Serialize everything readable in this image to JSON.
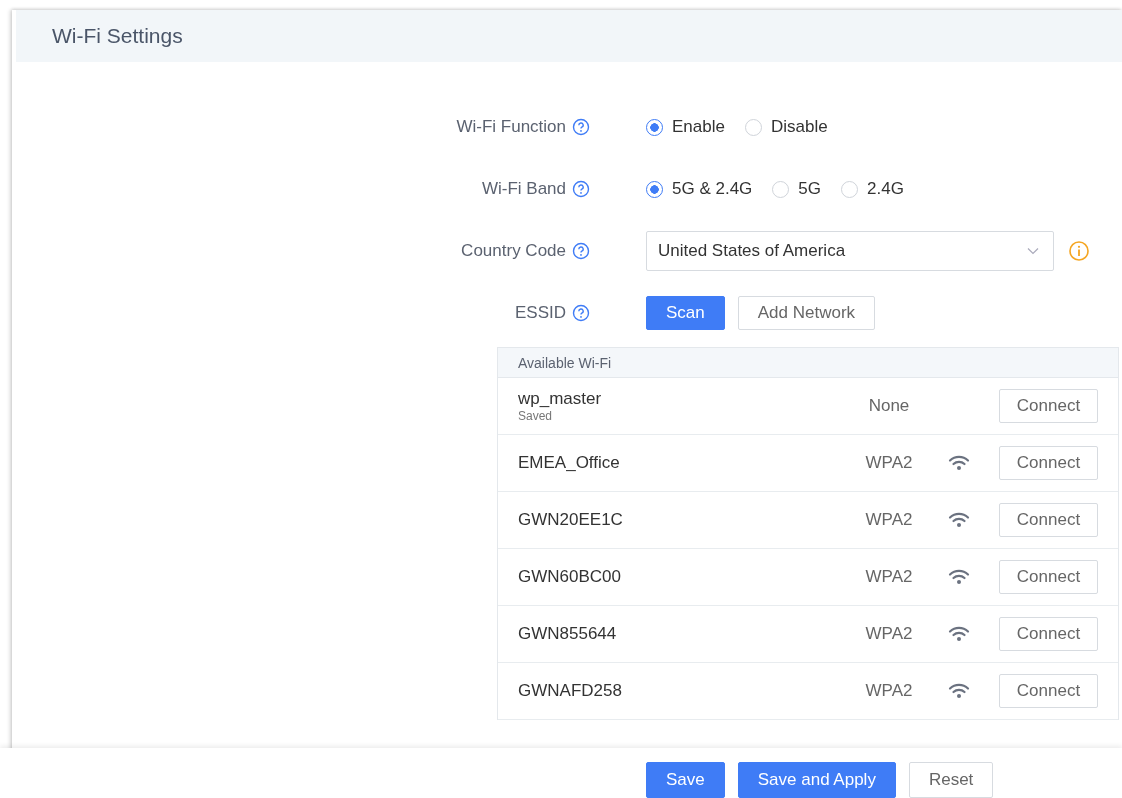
{
  "header": {
    "title": "Wi-Fi Settings"
  },
  "form": [
    {
      "kind": "radio",
      "label": "Wi-Fi Function",
      "options": [
        {
          "label": "Enable",
          "selected": true
        },
        {
          "label": "Disable",
          "selected": false
        }
      ]
    },
    {
      "kind": "radio",
      "label": "Wi-Fi Band",
      "options": [
        {
          "label": "5G & 2.4G",
          "selected": true
        },
        {
          "label": "5G",
          "selected": false
        },
        {
          "label": "2.4G",
          "selected": false
        }
      ]
    },
    {
      "kind": "select",
      "label": "Country Code",
      "value": "United States of America"
    },
    {
      "kind": "buttons",
      "label": "ESSID",
      "buttons": [
        {
          "label": "Scan",
          "primary": true
        },
        {
          "label": "Add Network",
          "primary": false
        }
      ]
    }
  ],
  "networks": {
    "title": "Available Wi-Fi",
    "rows": [
      {
        "name": "wp_master",
        "note": "Saved",
        "security": "None",
        "signal": false,
        "action": "Connect"
      },
      {
        "name": "EMEA_Office",
        "security": "WPA2",
        "signal": true,
        "action": "Connect"
      },
      {
        "name": "GWN20EE1C",
        "security": "WPA2",
        "signal": true,
        "action": "Connect"
      },
      {
        "name": "GWN60BC00",
        "security": "WPA2",
        "signal": true,
        "action": "Connect"
      },
      {
        "name": "GWN855644",
        "security": "WPA2",
        "signal": true,
        "action": "Connect"
      },
      {
        "name": "GWNAFD258",
        "security": "WPA2",
        "signal": true,
        "action": "Connect"
      }
    ]
  },
  "footer": [
    {
      "label": "Save",
      "primary": true
    },
    {
      "label": "Save and Apply",
      "primary": true
    },
    {
      "label": "Reset",
      "primary": false
    }
  ]
}
